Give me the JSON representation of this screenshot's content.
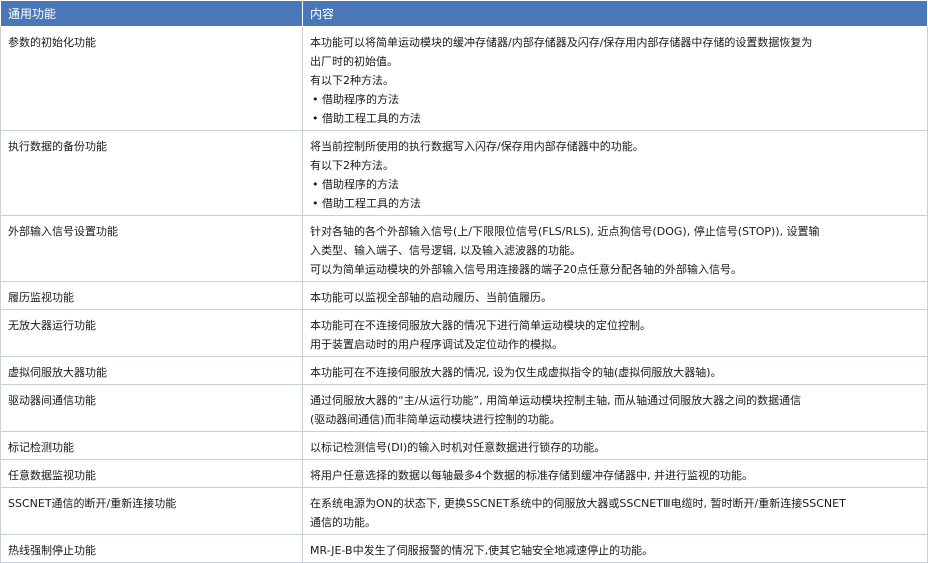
{
  "header": {
    "col1": "通用功能",
    "col2": "内容"
  },
  "rows": [
    {
      "name": "参数的初始化功能",
      "lines": [
        "本功能可以将简单运动模块的缓冲存储器/内部存储器及闪存/保存用内部存储器中存储的设置数据恢复为",
        "出厂时的初始值。",
        "有以下2种方法。",
        "• 借助程序的方法",
        "• 借助工程工具的方法"
      ]
    },
    {
      "name": "执行数据的备份功能",
      "lines": [
        "将当前控制所使用的执行数据写入闪存/保存用内部存储器中的功能。",
        "有以下2种方法。",
        "• 借助程序的方法",
        "• 借助工程工具的方法"
      ]
    },
    {
      "name": "外部输入信号设置功能",
      "lines": [
        "针对各轴的各个外部输入信号(上/下限限位信号(FLS/RLS), 近点狗信号(DOG), 停止信号(STOP)), 设置输",
        "入类型、输入端子、信号逻辑, 以及输入滤波器的功能。",
        "可以为简单运动模块的外部输入信号用连接器的端子20点任意分配各轴的外部输入信号。"
      ]
    },
    {
      "name": "履历监视功能",
      "lines": [
        "本功能可以监视全部轴的启动履历、当前值履历。"
      ]
    },
    {
      "name": "无放大器运行功能",
      "lines": [
        "本功能可在不连接伺服放大器的情况下进行简单运动模块的定位控制。",
        "用于装置启动时的用户程序调试及定位动作的模拟。"
      ]
    },
    {
      "name": "虚拟伺服放大器功能",
      "lines": [
        "本功能可在不连接伺服放大器的情况, 设为仅生成虚拟指令的轴(虚拟伺服放大器轴)。"
      ]
    },
    {
      "name": "驱动器间通信功能",
      "lines": [
        "通过伺服放大器的“主/从运行功能”, 用简单运动模块控制主轴, 而从轴通过伺服放大器之间的数据通信",
        "(驱动器间通信)而非简单运动模块进行控制的功能。"
      ]
    },
    {
      "name": "标记检测功能",
      "lines": [
        "以标记检测信号(DI)的输入时机对任意数据进行锁存的功能。"
      ]
    },
    {
      "name": "任意数据监视功能",
      "lines": [
        "将用户任意选择的数据以每轴最多4个数据的标准存储到缓冲存储器中, 并进行监视的功能。"
      ]
    },
    {
      "name": "SSCNET通信的断开/重新连接功能",
      "lines": [
        "在系统电源为ON的状态下, 更换SSCNET系统中的伺服放大器或SSCNETⅢ电缆时, 暂时断开/重新连接SSCNET",
        "通信的功能。"
      ]
    },
    {
      "name": "热线强制停止功能",
      "lines": [
        "MR-JE-B中发生了伺服报警的情况下,使其它轴安全地减速停止的功能。"
      ]
    }
  ]
}
